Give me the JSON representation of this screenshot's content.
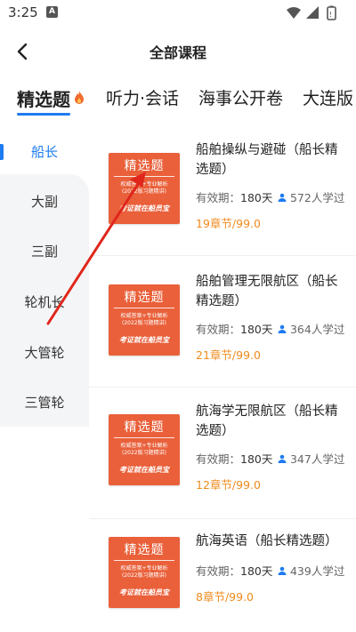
{
  "status": {
    "time": "3:25",
    "notification_icon": "A"
  },
  "header": {
    "title": "全部课程"
  },
  "tabs": [
    {
      "label": "精选题",
      "active": true
    },
    {
      "label": "听力·会话"
    },
    {
      "label": "海事公开卷"
    },
    {
      "label": "大连版"
    }
  ],
  "sidebar": {
    "items": [
      {
        "label": "船长",
        "active": true
      },
      {
        "label": "大副"
      },
      {
        "label": "三副"
      },
      {
        "label": "轮机长"
      },
      {
        "label": "大管轮"
      },
      {
        "label": "三管轮"
      }
    ]
  },
  "thumb": {
    "title": "精选题",
    "sub1": "权威答案+专业解析",
    "sub2": "(2022版习题精讲)",
    "brand": "考证就在船员宝"
  },
  "courses": [
    {
      "title": "船舶操纵与避碰（船长精选题）",
      "validity_label": "有效期：",
      "validity": "180天",
      "learners": "572人学过",
      "price": "19章节/99.0"
    },
    {
      "title": "船舶管理无限航区（船长精选题）",
      "validity_label": "有效期：",
      "validity": "180天",
      "learners": "364人学过",
      "price": "21章节/99.0"
    },
    {
      "title": "航海学无限航区（船长精选题）",
      "validity_label": "有效期：",
      "validity": "180天",
      "learners": "347人学过",
      "price": "12章节/99.0"
    },
    {
      "title": "航海英语（船长精选题）",
      "validity_label": "有效期：",
      "validity": "180天",
      "learners": "439人学过",
      "price": "8章节/99.0"
    }
  ],
  "colors": {
    "accent": "#1E7BF0",
    "price": "#F08A1C",
    "thumb": "#E9603A",
    "arrow": "#E0261B"
  }
}
